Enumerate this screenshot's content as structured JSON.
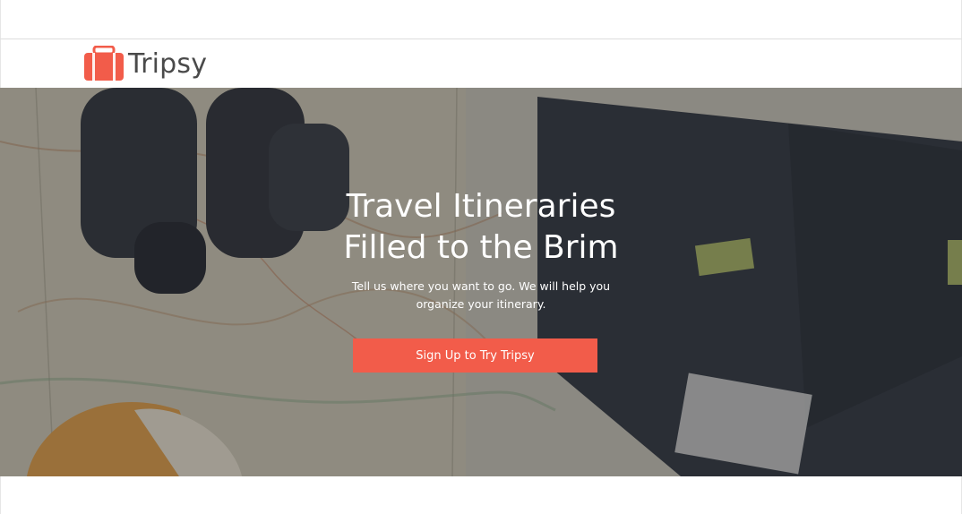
{
  "brand": {
    "name": "Tripsy",
    "accent_color": "#f25c4a",
    "logo_icon": "suitcase-icon"
  },
  "hero": {
    "title_line1": "Travel Itineraries",
    "title_line2": "Filled to the Brim",
    "subtitle_line1": "Tell us where you want to go. We will help you",
    "subtitle_line2": "organize your itinerary.",
    "cta_label": "Sign Up to Try Tripsy",
    "background": "map-binoculars-photo"
  }
}
